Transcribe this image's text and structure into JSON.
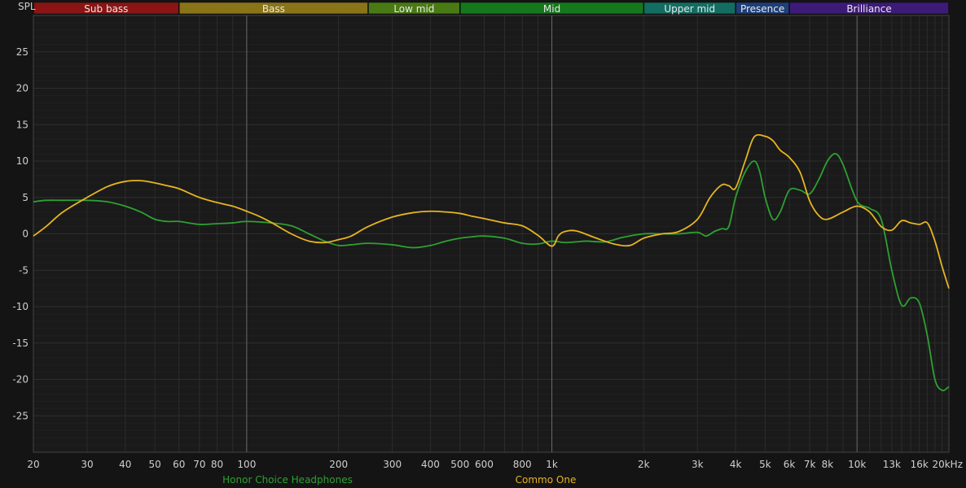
{
  "chart_data": {
    "type": "line",
    "ylabel": "SPL",
    "ylim": [
      -30,
      30
    ],
    "xlim": [
      20,
      20000
    ],
    "x_scale": "log",
    "grid": true,
    "y_ticks": [
      25,
      20,
      15,
      10,
      5,
      0,
      -5,
      -10,
      -15,
      -20,
      -25
    ],
    "y_tick_labels": [
      "25",
      "20",
      "15",
      "10",
      "5",
      "0",
      "-5",
      "-10",
      "-15",
      "-20",
      "-25"
    ],
    "x_ticks": [
      20,
      30,
      40,
      50,
      60,
      70,
      80,
      100,
      200,
      300,
      400,
      500,
      600,
      800,
      1000,
      2000,
      3000,
      4000,
      5000,
      6000,
      7000,
      8000,
      10000,
      13000,
      16000,
      20000
    ],
    "x_tick_labels": [
      "20",
      "30",
      "40",
      "50",
      "60",
      "70",
      "80",
      "100",
      "200",
      "300",
      "400",
      "500",
      "600",
      "800",
      "1k",
      "2k",
      "3k",
      "4k",
      "5k",
      "6k",
      "7k",
      "8k",
      "10k",
      "13k",
      "16k",
      "20kHz"
    ],
    "x_tick_dim": [
      "13k",
      "16k"
    ],
    "bands": [
      {
        "label": "Sub bass",
        "from": 20,
        "to": 60,
        "color": "#8b1414"
      },
      {
        "label": "Bass",
        "from": 60,
        "to": 250,
        "color": "#8a7418"
      },
      {
        "label": "Low mid",
        "from": 250,
        "to": 500,
        "color": "#4a7a14"
      },
      {
        "label": "Mid",
        "from": 500,
        "to": 2000,
        "color": "#16781c"
      },
      {
        "label": "Upper mid",
        "from": 2000,
        "to": 4000,
        "color": "#136d62"
      },
      {
        "label": "Presence",
        "from": 4000,
        "to": 6000,
        "color": "#1e3f78"
      },
      {
        "label": "Brilliance",
        "from": 6000,
        "to": 20000,
        "color": "#3e1a78"
      }
    ],
    "series": [
      {
        "name": "Honor Choice Headphones",
        "color": "#2ea032",
        "points": [
          [
            20,
            4.4
          ],
          [
            22,
            4.6
          ],
          [
            25,
            4.6
          ],
          [
            30,
            4.6
          ],
          [
            35,
            4.4
          ],
          [
            40,
            3.8
          ],
          [
            45,
            3.0
          ],
          [
            50,
            2.0
          ],
          [
            55,
            1.7
          ],
          [
            60,
            1.7
          ],
          [
            70,
            1.3
          ],
          [
            80,
            1.4
          ],
          [
            90,
            1.5
          ],
          [
            100,
            1.7
          ],
          [
            120,
            1.5
          ],
          [
            140,
            1.1
          ],
          [
            160,
            0.0
          ],
          [
            180,
            -1.0
          ],
          [
            200,
            -1.6
          ],
          [
            220,
            -1.5
          ],
          [
            250,
            -1.3
          ],
          [
            300,
            -1.5
          ],
          [
            350,
            -1.9
          ],
          [
            400,
            -1.6
          ],
          [
            450,
            -1.0
          ],
          [
            500,
            -0.6
          ],
          [
            550,
            -0.4
          ],
          [
            600,
            -0.3
          ],
          [
            700,
            -0.6
          ],
          [
            800,
            -1.3
          ],
          [
            900,
            -1.4
          ],
          [
            1000,
            -1.0
          ],
          [
            1100,
            -1.2
          ],
          [
            1200,
            -1.1
          ],
          [
            1300,
            -1.0
          ],
          [
            1500,
            -1.1
          ],
          [
            1700,
            -0.5
          ],
          [
            2000,
            0.0
          ],
          [
            2300,
            0.0
          ],
          [
            2600,
            0.0
          ],
          [
            3000,
            0.2
          ],
          [
            3200,
            -0.3
          ],
          [
            3400,
            0.3
          ],
          [
            3600,
            0.7
          ],
          [
            3800,
            1.0
          ],
          [
            4000,
            5.0
          ],
          [
            4300,
            8.5
          ],
          [
            4600,
            10.0
          ],
          [
            4800,
            8.5
          ],
          [
            5000,
            5.0
          ],
          [
            5300,
            2.0
          ],
          [
            5600,
            3.0
          ],
          [
            6000,
            6.0
          ],
          [
            6500,
            6.0
          ],
          [
            7000,
            5.5
          ],
          [
            7500,
            7.5
          ],
          [
            8000,
            10.0
          ],
          [
            8500,
            11.0
          ],
          [
            9000,
            9.5
          ],
          [
            10000,
            4.5
          ],
          [
            11000,
            3.5
          ],
          [
            12000,
            2.0
          ],
          [
            13000,
            -5.0
          ],
          [
            14000,
            -9.8
          ],
          [
            15000,
            -8.8
          ],
          [
            16000,
            -9.5
          ],
          [
            17000,
            -14.0
          ],
          [
            18000,
            -20.0
          ],
          [
            19000,
            -21.5
          ],
          [
            20000,
            -21.0
          ]
        ]
      },
      {
        "name": "Commo One",
        "color": "#e6b422",
        "points": [
          [
            20,
            -0.3
          ],
          [
            22,
            1.0
          ],
          [
            25,
            3.0
          ],
          [
            30,
            5.0
          ],
          [
            35,
            6.5
          ],
          [
            40,
            7.2
          ],
          [
            45,
            7.3
          ],
          [
            50,
            7.0
          ],
          [
            55,
            6.6
          ],
          [
            60,
            6.2
          ],
          [
            70,
            5.0
          ],
          [
            80,
            4.3
          ],
          [
            90,
            3.8
          ],
          [
            100,
            3.1
          ],
          [
            110,
            2.4
          ],
          [
            120,
            1.6
          ],
          [
            140,
            0.0
          ],
          [
            160,
            -1.0
          ],
          [
            180,
            -1.2
          ],
          [
            200,
            -0.8
          ],
          [
            220,
            -0.3
          ],
          [
            250,
            1.0
          ],
          [
            300,
            2.3
          ],
          [
            350,
            2.9
          ],
          [
            400,
            3.1
          ],
          [
            450,
            3.0
          ],
          [
            500,
            2.8
          ],
          [
            550,
            2.4
          ],
          [
            600,
            2.1
          ],
          [
            700,
            1.5
          ],
          [
            800,
            1.1
          ],
          [
            900,
            -0.2
          ],
          [
            1000,
            -1.7
          ],
          [
            1050,
            -0.3
          ],
          [
            1100,
            0.3
          ],
          [
            1200,
            0.4
          ],
          [
            1400,
            -0.6
          ],
          [
            1600,
            -1.4
          ],
          [
            1800,
            -1.6
          ],
          [
            2000,
            -0.6
          ],
          [
            2300,
            0.0
          ],
          [
            2600,
            0.3
          ],
          [
            3000,
            2.0
          ],
          [
            3300,
            5.0
          ],
          [
            3600,
            6.7
          ],
          [
            3800,
            6.6
          ],
          [
            4000,
            6.3
          ],
          [
            4300,
            10.0
          ],
          [
            4600,
            13.3
          ],
          [
            5000,
            13.4
          ],
          [
            5300,
            12.8
          ],
          [
            5600,
            11.5
          ],
          [
            6000,
            10.5
          ],
          [
            6500,
            8.5
          ],
          [
            7000,
            4.5
          ],
          [
            7500,
            2.5
          ],
          [
            8000,
            2.0
          ],
          [
            9000,
            3.0
          ],
          [
            10000,
            3.8
          ],
          [
            11000,
            3.0
          ],
          [
            12000,
            1.0
          ],
          [
            13000,
            0.5
          ],
          [
            14000,
            1.8
          ],
          [
            15000,
            1.5
          ],
          [
            16000,
            1.3
          ],
          [
            17000,
            1.5
          ],
          [
            18000,
            -1.0
          ],
          [
            19000,
            -4.5
          ],
          [
            20000,
            -7.5
          ]
        ]
      }
    ]
  }
}
